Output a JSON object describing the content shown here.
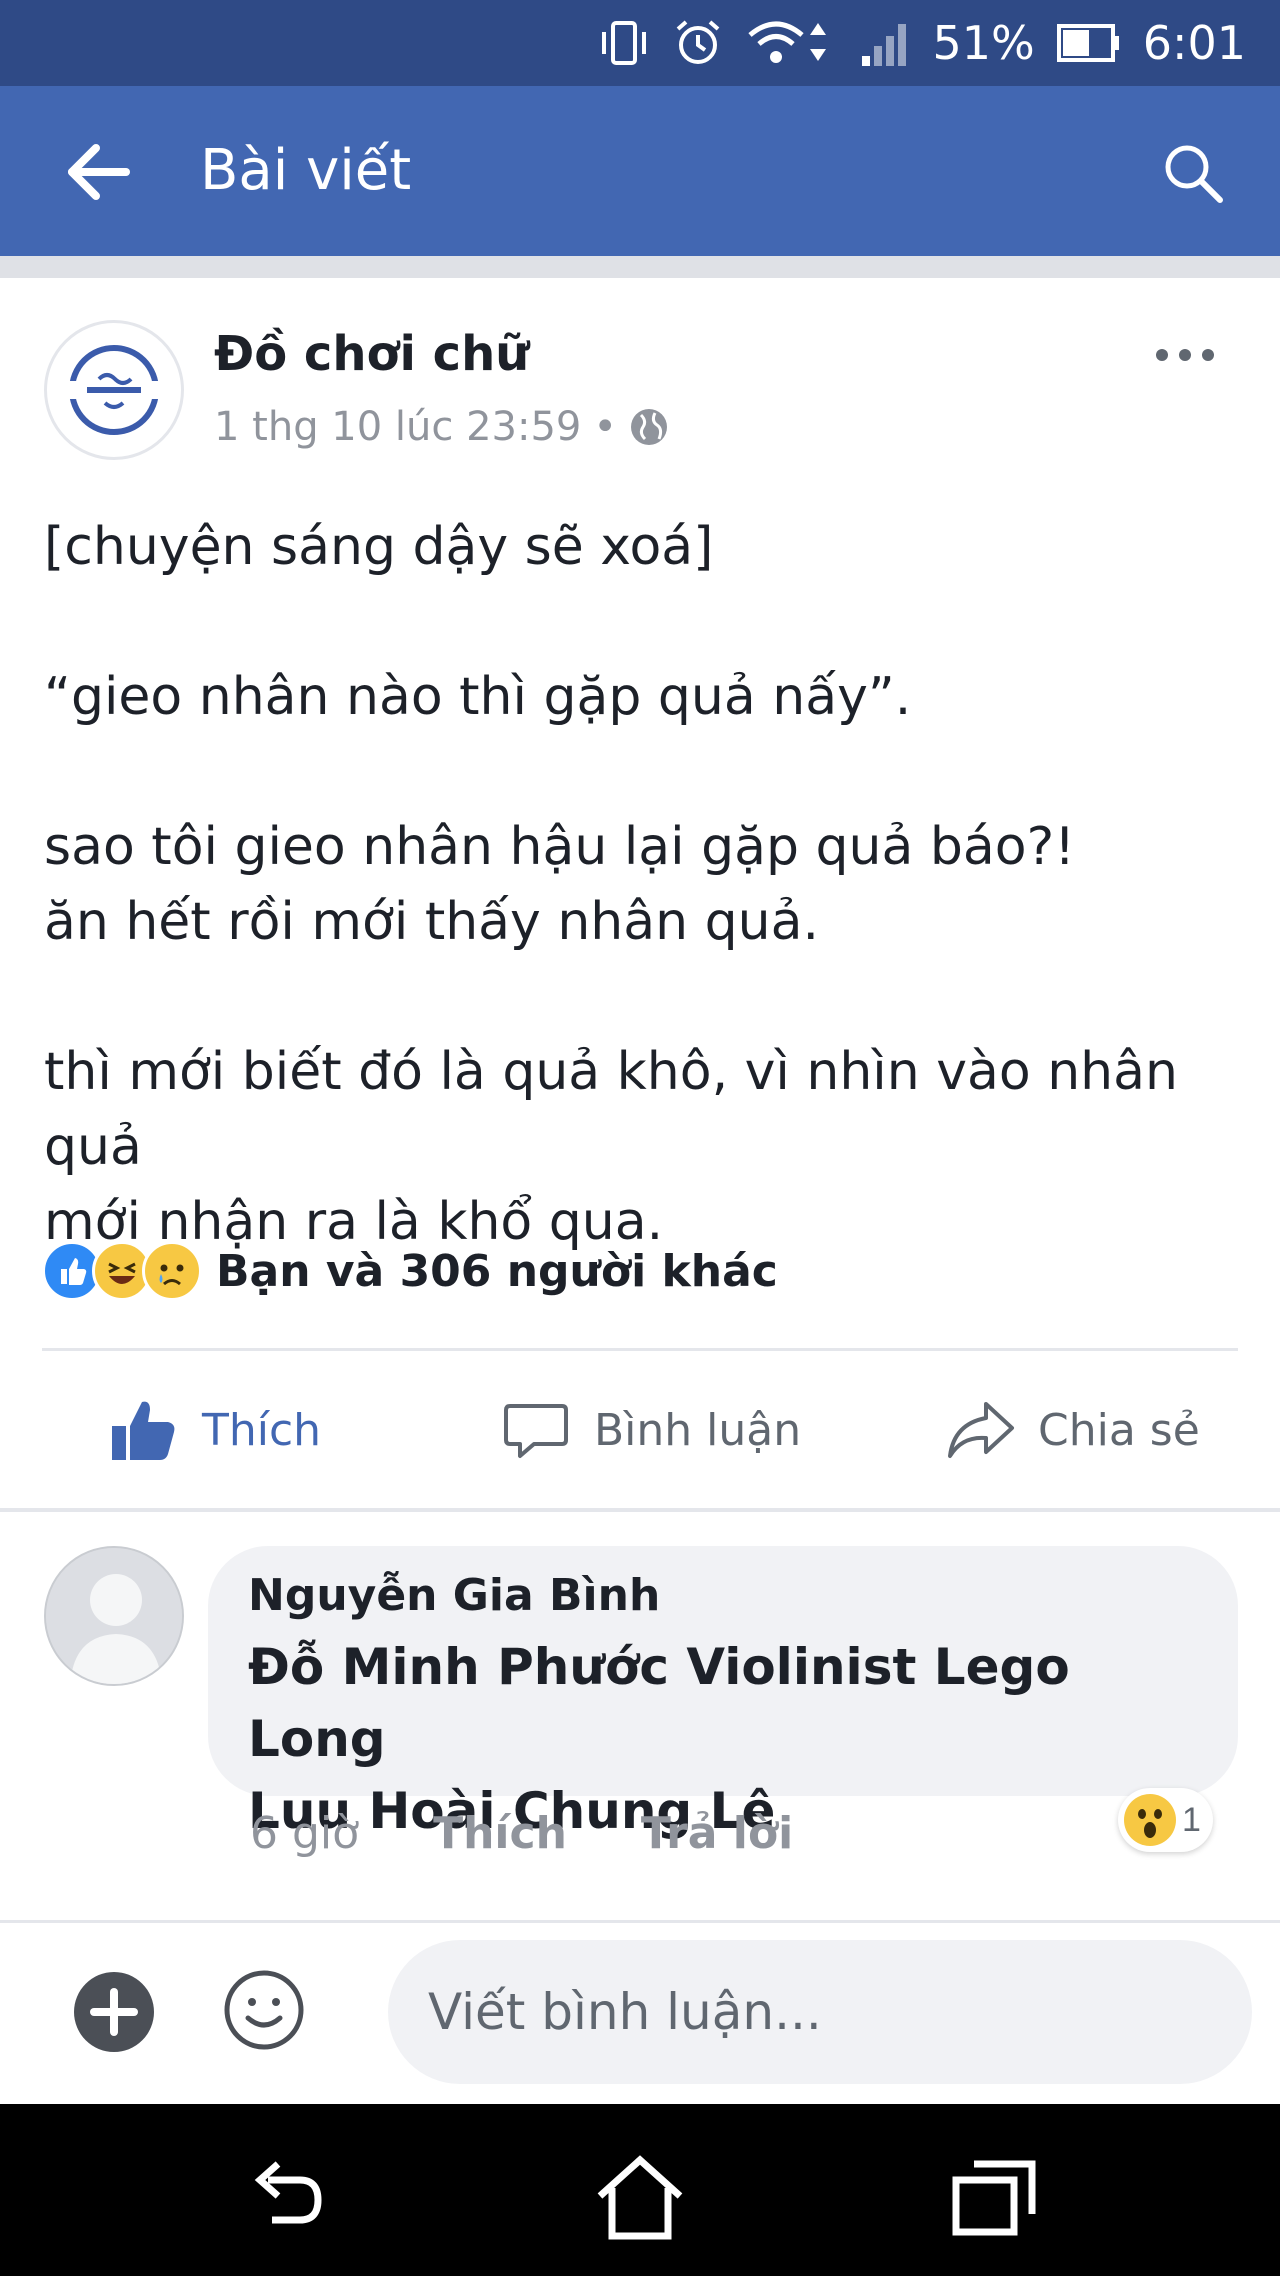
{
  "status_bar": {
    "battery_percent": "51%",
    "time": "6:01",
    "icons": [
      "vibrate-icon",
      "alarm-icon",
      "wifi-icon",
      "signal-icon",
      "battery-icon"
    ]
  },
  "app_bar": {
    "title": "Bài viết",
    "back_icon": "arrow-left-icon",
    "search_icon": "search-icon",
    "background": "#4267b2"
  },
  "post": {
    "page_name": "Đồ chơi chữ",
    "timestamp": "1 thg 10 lúc 23:59",
    "separator": "•",
    "privacy_icon": "globe-icon",
    "paragraphs": [
      [
        "[chuyện sáng dậy sẽ xoá]"
      ],
      [
        "“gieo nhân nào thì gặp quả nấy”."
      ],
      [
        "sao tôi gieo nhân hậu lại gặp quả báo?!",
        "ăn hết rồi mới thấy nhân quả."
      ],
      [
        "thì mới biết đó là quả khô, vì nhìn vào nhân quả",
        "mới nhận ra là khổ qua."
      ]
    ],
    "reactions_text": "Bạn và 306 người khác",
    "reaction_icons": [
      "like-icon",
      "haha-icon",
      "sad-icon"
    ]
  },
  "actions": {
    "like": "Thích",
    "comment": "Bình luận",
    "share": "Chia sẻ"
  },
  "comment": {
    "author": "Nguyễn Gia Bình",
    "text_line1": "Đỗ Minh Phước Violinist Lego Long",
    "text_line2": "Luu Hoài Chung Lê",
    "time": "6 giờ",
    "like": "Thích",
    "reply": "Trả lời",
    "reaction_count": "1",
    "reaction_icon": "wow-icon"
  },
  "composer": {
    "placeholder": "Viết bình luận..."
  },
  "colors": {
    "brand": "#4267b2",
    "status_bar": "#2f4a86",
    "text": "#1d2129",
    "muted": "#90949c"
  }
}
